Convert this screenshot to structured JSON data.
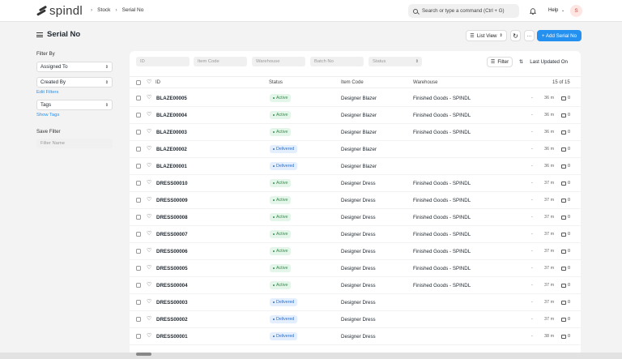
{
  "navbar": {
    "brand": "spindl",
    "breadcrumbs": [
      "Stock",
      "Serial No"
    ],
    "search_placeholder": "Search or type a command (Ctrl + G)",
    "help_label": "Help",
    "avatar_initial": "S"
  },
  "page": {
    "title": "Serial No",
    "list_view_label": "List View",
    "more_label": "···",
    "add_label": "+ Add Serial No"
  },
  "sidebar": {
    "filter_by_label": "Filter By",
    "assigned_to": "Assigned To",
    "created_by": "Created By",
    "edit_filters": "Edit Filters",
    "tags": "Tags",
    "show_tags": "Show Tags",
    "save_filter_label": "Save Filter",
    "filter_name_placeholder": "Filter Name"
  },
  "filters": {
    "id": "ID",
    "item_code": "Item Code",
    "warehouse": "Warehouse",
    "batch_no": "Batch No",
    "status": "Status",
    "filter_button": "Filter",
    "sort_label": "Last Updated On"
  },
  "table": {
    "headers": {
      "id": "ID",
      "status": "Status",
      "item_code": "Item Code",
      "warehouse": "Warehouse"
    },
    "count": "15 of 15",
    "rows": [
      {
        "id": "BLAZE00005",
        "status": "Active",
        "status_kind": "active",
        "item_code": "Designer Blazer",
        "warehouse": "Finished Goods - SPINDL",
        "dash": "-",
        "time": "36 m",
        "comments": "0"
      },
      {
        "id": "BLAZE00004",
        "status": "Active",
        "status_kind": "active",
        "item_code": "Designer Blazer",
        "warehouse": "Finished Goods - SPINDL",
        "dash": "-",
        "time": "36 m",
        "comments": "0"
      },
      {
        "id": "BLAZE00003",
        "status": "Active",
        "status_kind": "active",
        "item_code": "Designer Blazer",
        "warehouse": "Finished Goods - SPINDL",
        "dash": "-",
        "time": "36 m",
        "comments": "0"
      },
      {
        "id": "BLAZE00002",
        "status": "Delivered",
        "status_kind": "delivered",
        "item_code": "Designer Blazer",
        "warehouse": "",
        "dash": "-",
        "time": "36 m",
        "comments": "0"
      },
      {
        "id": "BLAZE00001",
        "status": "Delivered",
        "status_kind": "delivered",
        "item_code": "Designer Blazer",
        "warehouse": "",
        "dash": "-",
        "time": "36 m",
        "comments": "0"
      },
      {
        "id": "DRESS00010",
        "status": "Active",
        "status_kind": "active",
        "item_code": "Designer Dress",
        "warehouse": "Finished Goods - SPINDL",
        "dash": "-",
        "time": "37 m",
        "comments": "0"
      },
      {
        "id": "DRESS00009",
        "status": "Active",
        "status_kind": "active",
        "item_code": "Designer Dress",
        "warehouse": "Finished Goods - SPINDL",
        "dash": "-",
        "time": "37 m",
        "comments": "0"
      },
      {
        "id": "DRESS00008",
        "status": "Active",
        "status_kind": "active",
        "item_code": "Designer Dress",
        "warehouse": "Finished Goods - SPINDL",
        "dash": "-",
        "time": "37 m",
        "comments": "0"
      },
      {
        "id": "DRESS00007",
        "status": "Active",
        "status_kind": "active",
        "item_code": "Designer Dress",
        "warehouse": "Finished Goods - SPINDL",
        "dash": "-",
        "time": "37 m",
        "comments": "0"
      },
      {
        "id": "DRESS00006",
        "status": "Active",
        "status_kind": "active",
        "item_code": "Designer Dress",
        "warehouse": "Finished Goods - SPINDL",
        "dash": "-",
        "time": "37 m",
        "comments": "0"
      },
      {
        "id": "DRESS00005",
        "status": "Active",
        "status_kind": "active",
        "item_code": "Designer Dress",
        "warehouse": "Finished Goods - SPINDL",
        "dash": "-",
        "time": "37 m",
        "comments": "0"
      },
      {
        "id": "DRESS00004",
        "status": "Active",
        "status_kind": "active",
        "item_code": "Designer Dress",
        "warehouse": "Finished Goods - SPINDL",
        "dash": "-",
        "time": "37 m",
        "comments": "0"
      },
      {
        "id": "DRESS00003",
        "status": "Delivered",
        "status_kind": "delivered",
        "item_code": "Designer Dress",
        "warehouse": "",
        "dash": "-",
        "time": "37 m",
        "comments": "0"
      },
      {
        "id": "DRESS00002",
        "status": "Delivered",
        "status_kind": "delivered",
        "item_code": "Designer Dress",
        "warehouse": "",
        "dash": "-",
        "time": "37 m",
        "comments": "0"
      },
      {
        "id": "DRESS00001",
        "status": "Delivered",
        "status_kind": "delivered",
        "item_code": "Designer Dress",
        "warehouse": "",
        "dash": "-",
        "time": "38 m",
        "comments": "0"
      }
    ]
  },
  "colors": {
    "primary": "#2490ef",
    "active_text": "#2f8f49",
    "delivered_text": "#2c6ec6"
  },
  "icons": [
    "search-icon",
    "bell-icon",
    "menu-icon",
    "refresh-icon",
    "filter-icon",
    "sort-icon",
    "heart-icon",
    "comment-icon"
  ]
}
